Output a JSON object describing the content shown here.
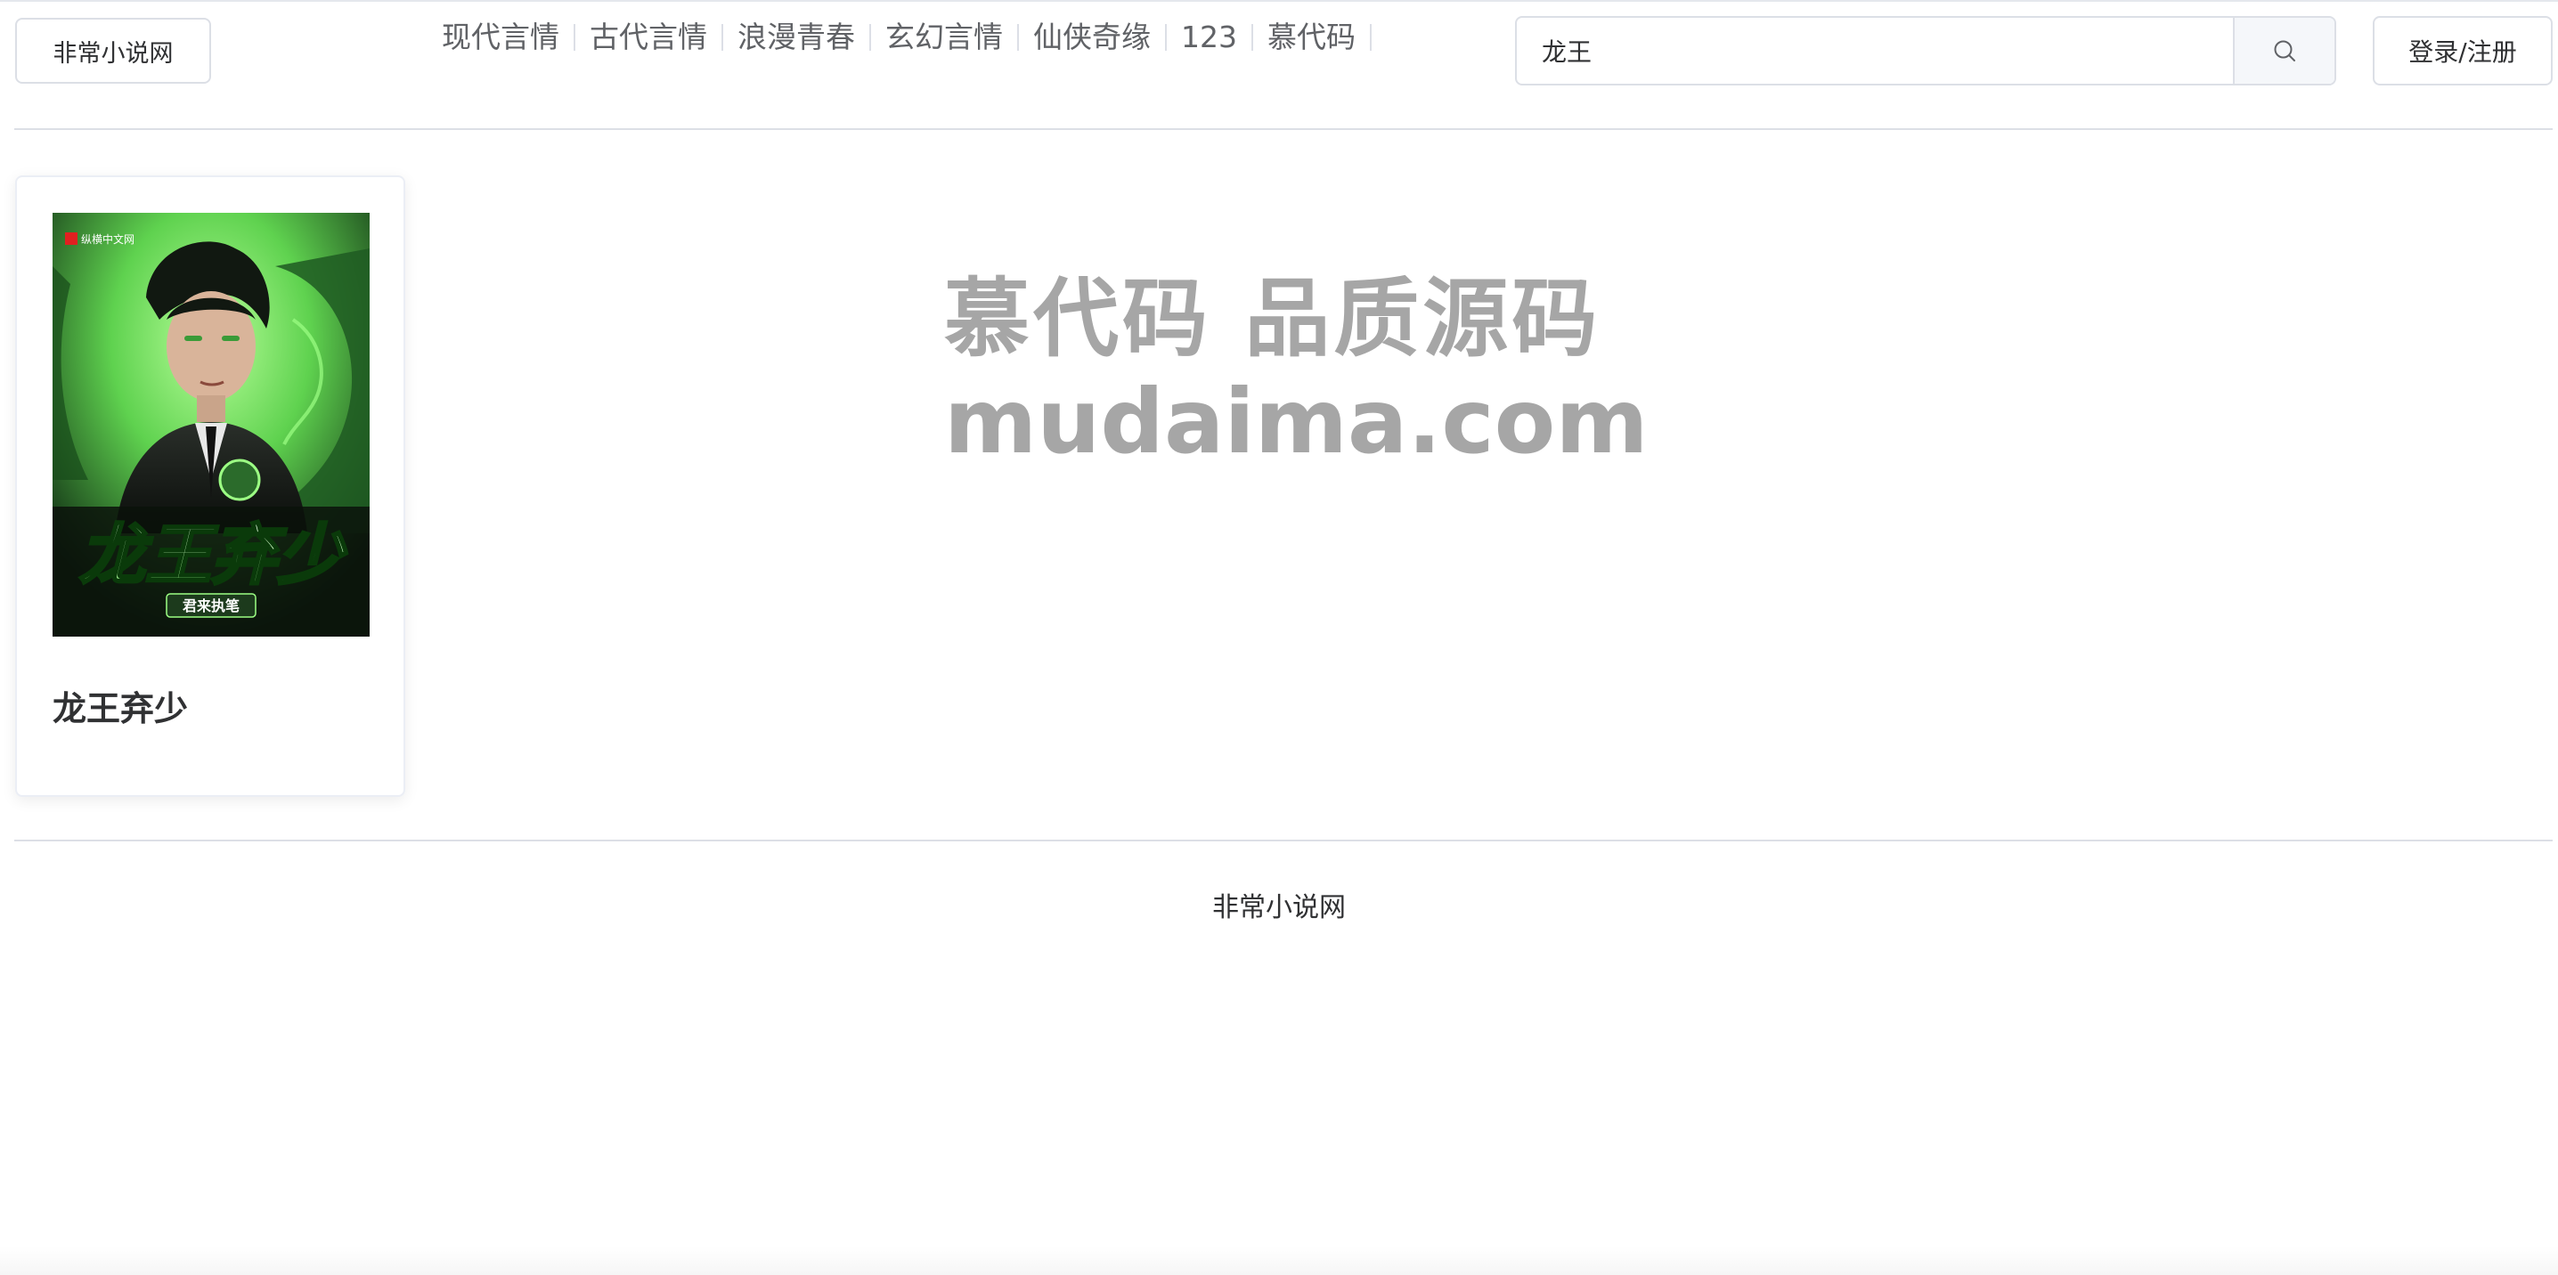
{
  "header": {
    "site_name": "非常小说网",
    "nav": [
      {
        "label": "现代言情"
      },
      {
        "label": "古代言情"
      },
      {
        "label": "浪漫青春"
      },
      {
        "label": "玄幻言情"
      },
      {
        "label": "仙侠奇缘"
      },
      {
        "label": "123"
      },
      {
        "label": "慕代码"
      }
    ],
    "search": {
      "value": "龙王",
      "icon": "search-icon"
    },
    "login_label": "登录/注册"
  },
  "results": [
    {
      "title": "龙王弃少",
      "cover": {
        "publisher": "纵横中文网",
        "title_art": "龙王弃少",
        "author_tag": "君来执笔",
        "accent_color": "#7cf06a"
      }
    }
  ],
  "watermark": {
    "line1": "慕代码 品质源码",
    "line2": "mudaima.com"
  },
  "footer": {
    "text": "非常小说网"
  }
}
